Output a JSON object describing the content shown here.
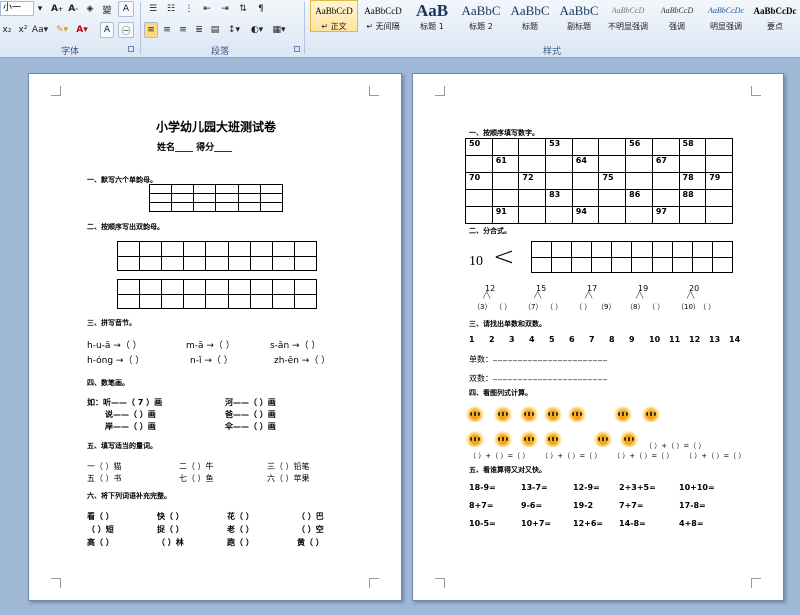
{
  "ribbon": {
    "font_size": "小一",
    "font_group_label": "字体",
    "paragraph_group_label": "段落",
    "styles_group_label": "样式",
    "styles": [
      {
        "sample": "AaBbCcD",
        "name": "↵ 正文"
      },
      {
        "sample": "AaBbCcD",
        "name": "↵ 无间隔"
      },
      {
        "sample": "AaB",
        "name": "标题 1"
      },
      {
        "sample": "AaBbC",
        "name": "标题 2"
      },
      {
        "sample": "AaBbC",
        "name": "标题"
      },
      {
        "sample": "AaBbC",
        "name": "副标题"
      },
      {
        "sample": "AaBbCcD",
        "name": "不明显强调"
      },
      {
        "sample": "AaBbCcD",
        "name": "强调"
      },
      {
        "sample": "AaBbCcDc",
        "name": "明显强调"
      },
      {
        "sample": "AaBbCcDc",
        "name": "要点"
      }
    ],
    "accent_color": "#e5b64a"
  },
  "page1": {
    "title": "小学幼儿园大班测试卷",
    "name_line": "姓名____  得分____",
    "s1": "一、默写六个单韵母。",
    "s2": "二、按顺序写出双韵母。",
    "s3": "三、拼写音节。",
    "pinyin": [
      "h-u-ā →（   ）",
      "m-ā →（   ）",
      "s-ǎn →（   ）",
      "h-óng →（   ）",
      "n-ǐ →（   ）",
      "zh-ēn →（   ）"
    ],
    "s4": "四、数笔画。",
    "strokes": [
      "如：听——（ 7 ）画",
      "河——（    ）画",
      "说——（    ）画",
      "爸——（    ）画",
      "岸——（    ）画",
      "伞——（    ）画"
    ],
    "s5": "五、填写适当的量词。",
    "measure": [
      "一（   ）猫",
      "二（   ）牛",
      "三（   ）铅笔",
      "五（   ）书",
      "七（   ）鱼",
      "六（   ）苹果"
    ],
    "s6": "六、将下列词语补充完整。",
    "words": [
      "看（   ）",
      "快（   ）",
      "花（   ）",
      "（   ）巴",
      "（   ）短",
      "捉（   ）",
      "老（   ）",
      "（   ）空",
      "高（   ）",
      "（   ）林",
      "跑（   ）",
      "黄（   ）"
    ]
  },
  "page2": {
    "s1": "一、按顺序填写数字。",
    "num_grid": [
      [
        "50",
        "",
        "",
        "53",
        "",
        "",
        "56",
        "",
        "58",
        ""
      ],
      [
        "",
        "61",
        "",
        "",
        "64",
        "",
        "",
        "67",
        "",
        ""
      ],
      [
        "70",
        "",
        "72",
        "",
        "",
        "75",
        "",
        "",
        "78",
        "79"
      ],
      [
        "",
        "",
        "",
        "83",
        "",
        "",
        "86",
        "",
        "88",
        ""
      ],
      [
        "",
        "91",
        "",
        "",
        "94",
        "",
        "",
        "97",
        "",
        ""
      ]
    ],
    "s2": "二、分合式。",
    "ten": "10",
    "less_than": "<",
    "splits": [
      {
        "top": "12",
        "left": "（3）",
        "right": "（  ）"
      },
      {
        "top": "15",
        "left": "（7）",
        "right": "（  ）"
      },
      {
        "top": "17",
        "left": "（  ）",
        "right": "（9）"
      },
      {
        "top": "19",
        "left": "（8）",
        "right": "（  ）"
      },
      {
        "top": "20",
        "left": "（10）",
        "right": "（  ）"
      }
    ],
    "s3": "三、请找出单数和双数。",
    "numbers": [
      "1",
      "2",
      "3",
      "4",
      "5",
      "6",
      "7",
      "8",
      "9",
      "10",
      "11",
      "12",
      "13",
      "14"
    ],
    "odd_label": "单数：",
    "even_label": "双数：",
    "blank_line": "_______________________",
    "s4": "四、看图列式计算。",
    "eq1": "（  ）+（  ）=（  ）",
    "eq_row": [
      "（  ）+（  ）=（  ）",
      "（  ）+（  ）=（  ）",
      "（  ）+（  ）=（  ）",
      "（  ）+（  ）=（  ）"
    ],
    "s5": "五、看谁算得又对又快。",
    "calc": [
      [
        "18-9=",
        "13-7=",
        "12-9=",
        "2+3+5=",
        "10+10="
      ],
      [
        "8+7=",
        "9-6=",
        "19-2",
        "7+7=",
        "17-8="
      ],
      [
        "10-5=",
        "10+7=",
        "12+6=",
        "14-8=",
        "4+8="
      ]
    ]
  }
}
